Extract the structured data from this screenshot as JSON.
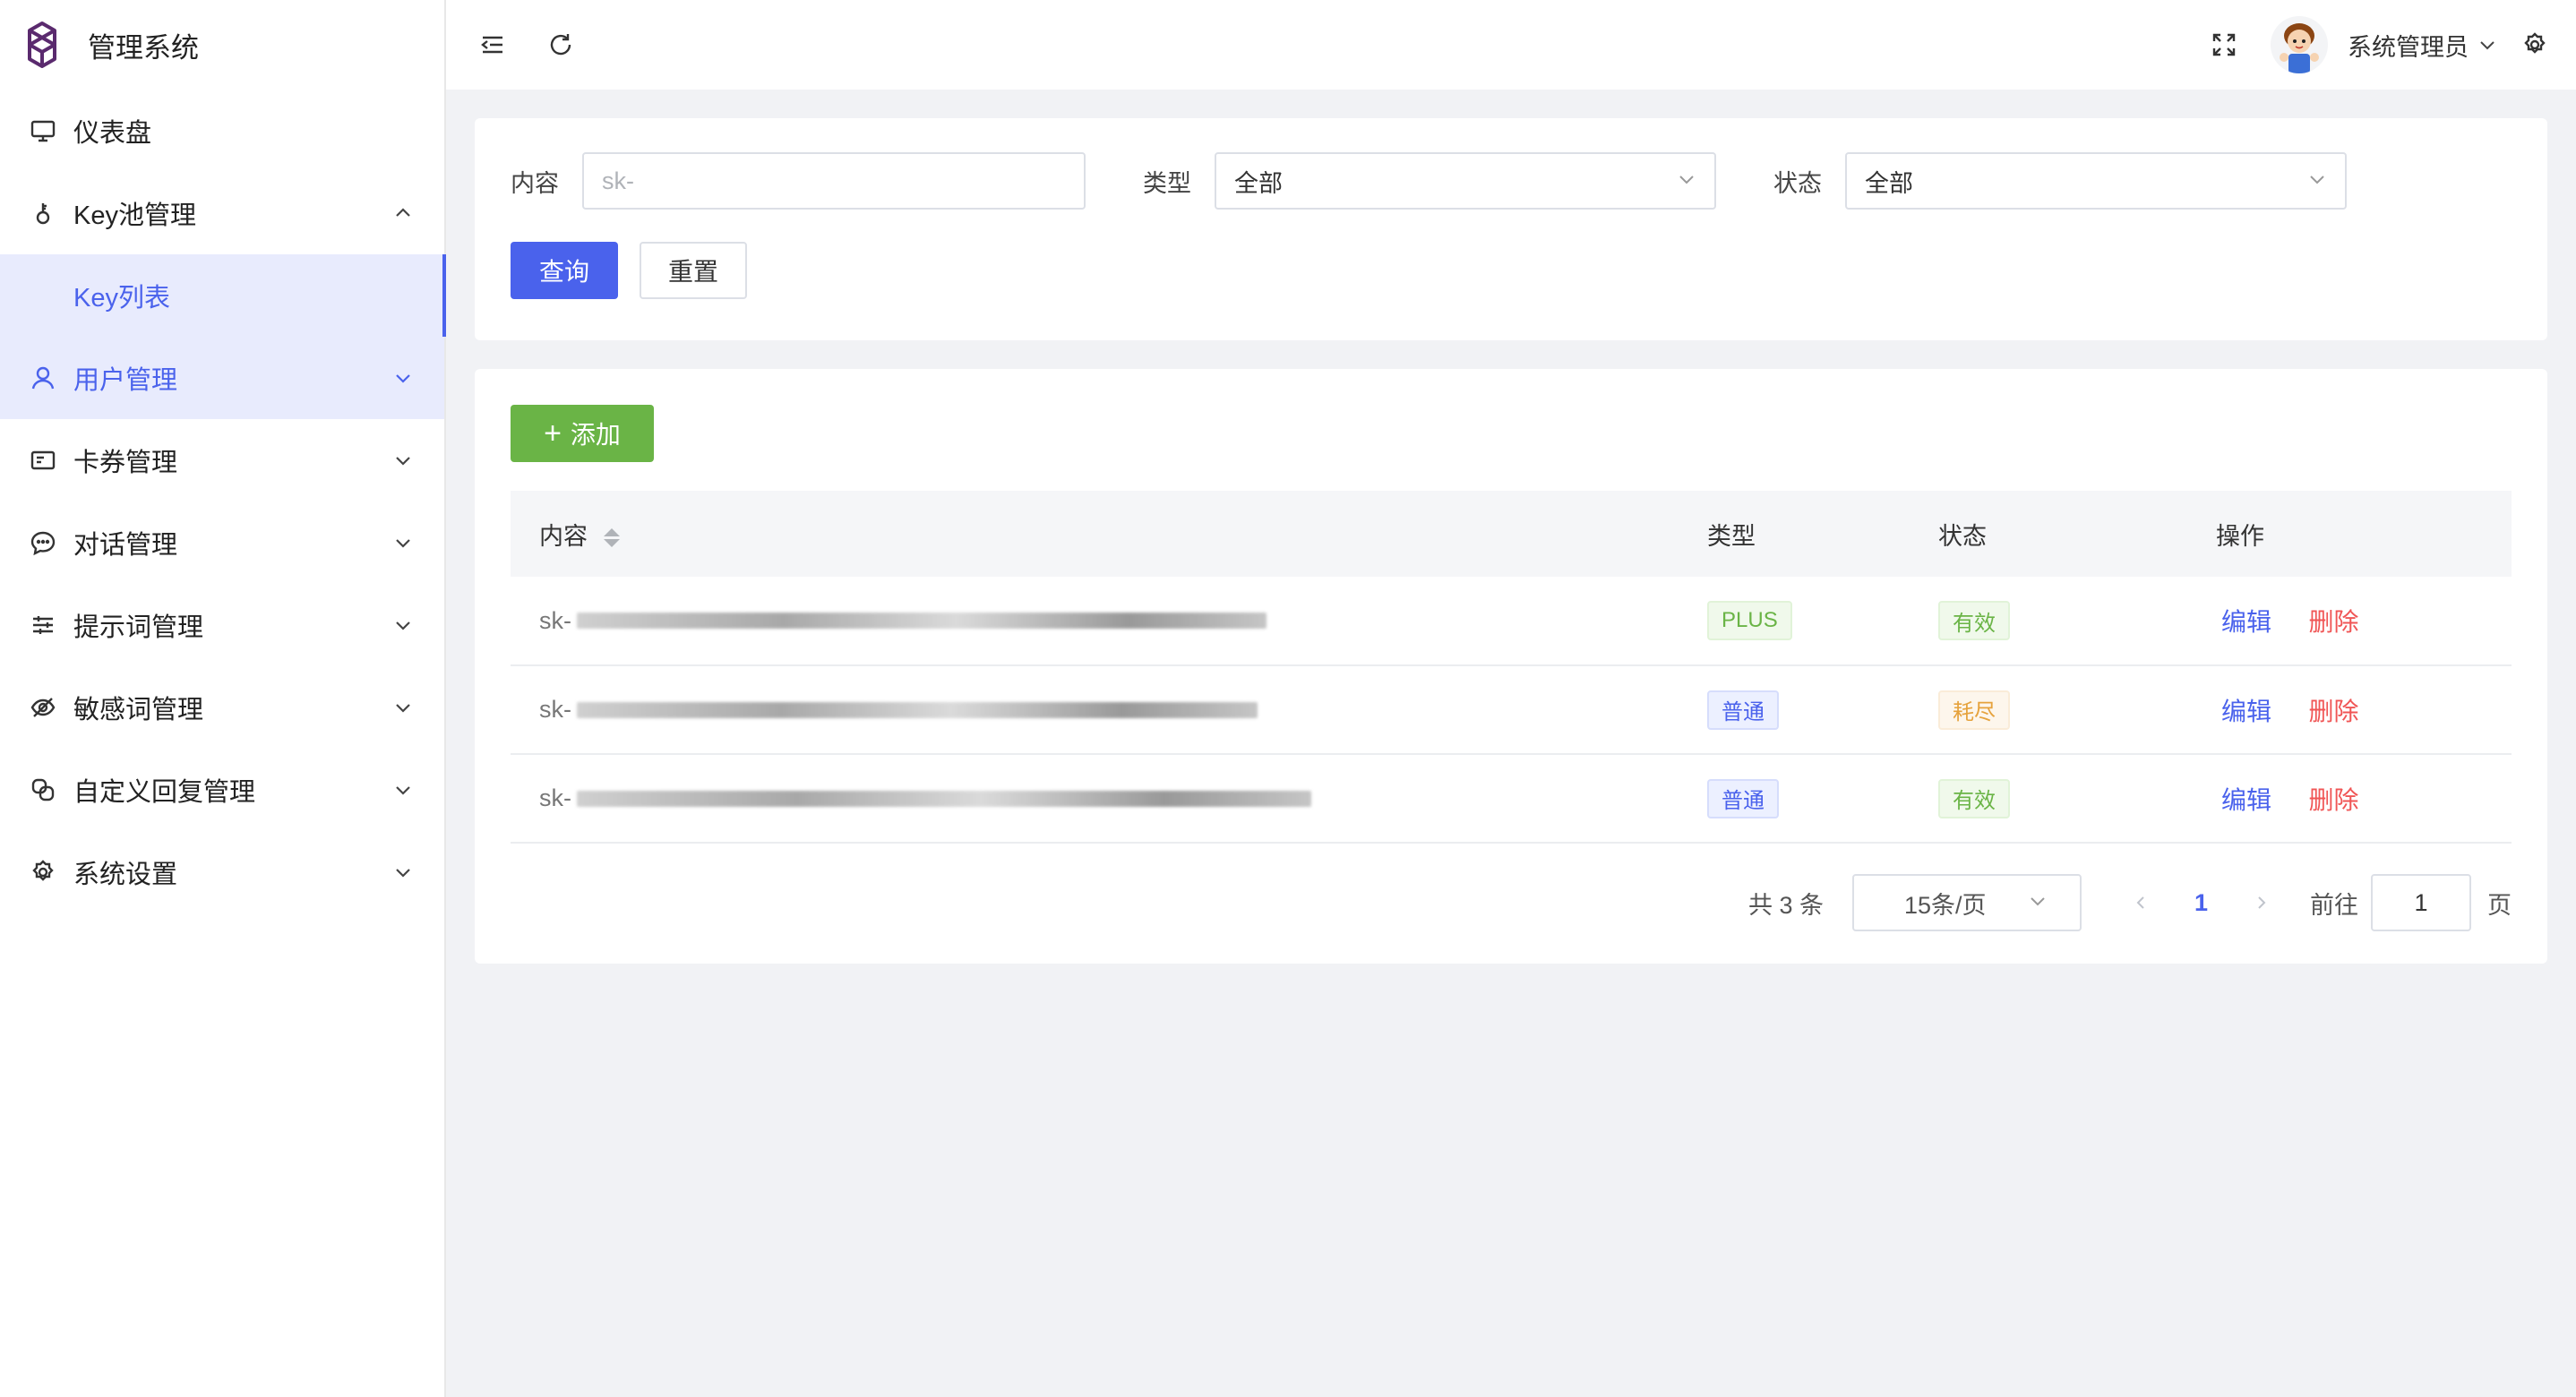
{
  "app": {
    "title": "管理系统"
  },
  "sidebar": {
    "items": [
      {
        "label": "仪表盘",
        "icon": "monitor-icon"
      },
      {
        "label": "Key池管理",
        "icon": "key-icon",
        "expanded": true
      },
      {
        "label": "Key列表",
        "active": true
      },
      {
        "label": "用户管理",
        "icon": "user-icon",
        "highlight": true
      },
      {
        "label": "卡券管理",
        "icon": "card-icon"
      },
      {
        "label": "对话管理",
        "icon": "chat-icon"
      },
      {
        "label": "提示词管理",
        "icon": "sliders-icon"
      },
      {
        "label": "敏感词管理",
        "icon": "eye-off-icon"
      },
      {
        "label": "自定义回复管理",
        "icon": "copy-icon"
      },
      {
        "label": "系统设置",
        "icon": "gear-icon"
      }
    ]
  },
  "topbar": {
    "username": "系统管理员"
  },
  "search": {
    "content_label": "内容",
    "content_placeholder": "sk-",
    "type_label": "类型",
    "type_value": "全部",
    "status_label": "状态",
    "status_value": "全部",
    "query_label": "查询",
    "reset_label": "重置"
  },
  "table": {
    "add_label": "添加",
    "headers": {
      "content": "内容",
      "type": "类型",
      "status": "状态",
      "ops": "操作"
    },
    "rows": [
      {
        "content": "sk-",
        "type": "PLUS",
        "status": "有效"
      },
      {
        "content": "sk-",
        "type": "普通",
        "status": "耗尽"
      },
      {
        "content": "sk-",
        "type": "普通",
        "status": "有效"
      }
    ],
    "edit_label": "编辑",
    "delete_label": "删除"
  },
  "pagination": {
    "total": "共 3 条",
    "page_size": "15条/页",
    "current_page": "1",
    "goto_label": "前往",
    "goto_value": "1",
    "page_suffix": "页"
  },
  "colors": {
    "primary": "#4a62ec",
    "success": "#6ab446",
    "danger": "#f05656",
    "warning": "#e6a23c"
  }
}
